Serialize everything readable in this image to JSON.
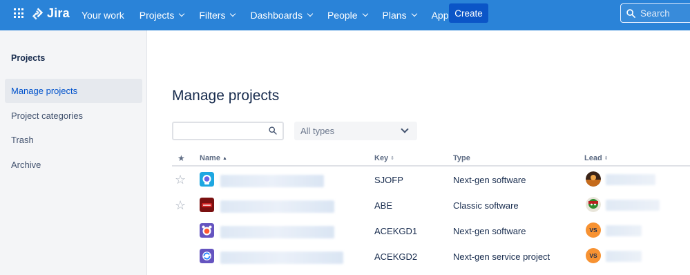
{
  "nav": {
    "product": "Jira",
    "items": [
      {
        "label": "Your work",
        "dropdown": false
      },
      {
        "label": "Projects",
        "dropdown": true
      },
      {
        "label": "Filters",
        "dropdown": true
      },
      {
        "label": "Dashboards",
        "dropdown": true
      },
      {
        "label": "People",
        "dropdown": true
      },
      {
        "label": "Plans",
        "dropdown": true
      },
      {
        "label": "Apps",
        "dropdown": true
      }
    ],
    "create_label": "Create",
    "search_placeholder": "Search",
    "colors": {
      "bar": "#2a83d8",
      "create": "#0b55c7"
    }
  },
  "sidebar": {
    "heading": "Projects",
    "items": [
      {
        "label": "Manage projects",
        "active": true
      },
      {
        "label": "Project categories",
        "active": false
      },
      {
        "label": "Trash",
        "active": false
      },
      {
        "label": "Archive",
        "active": false
      }
    ]
  },
  "main": {
    "title": "Manage projects",
    "filter_value": "",
    "type_select": "All types",
    "columns": {
      "name": "Name",
      "key": "Key",
      "type": "Type",
      "lead": "Lead"
    },
    "rows": [
      {
        "starred": true,
        "key": "SJOFP",
        "type": "Next-gen software",
        "icon": "robot-icon",
        "lead_avatar": "photo"
      },
      {
        "starred": true,
        "key": "ABE",
        "type": "Classic software",
        "icon": "dark-red-icon",
        "lead_avatar": "photo"
      },
      {
        "starred": false,
        "key": "ACEKGD1",
        "type": "Next-gen software",
        "icon": "alarm-clock-icon",
        "lead_avatar": "VS"
      },
      {
        "starred": false,
        "key": "ACEKGD2",
        "type": "Next-gen service project",
        "icon": "refresh-icon",
        "lead_avatar": "VS"
      }
    ]
  }
}
